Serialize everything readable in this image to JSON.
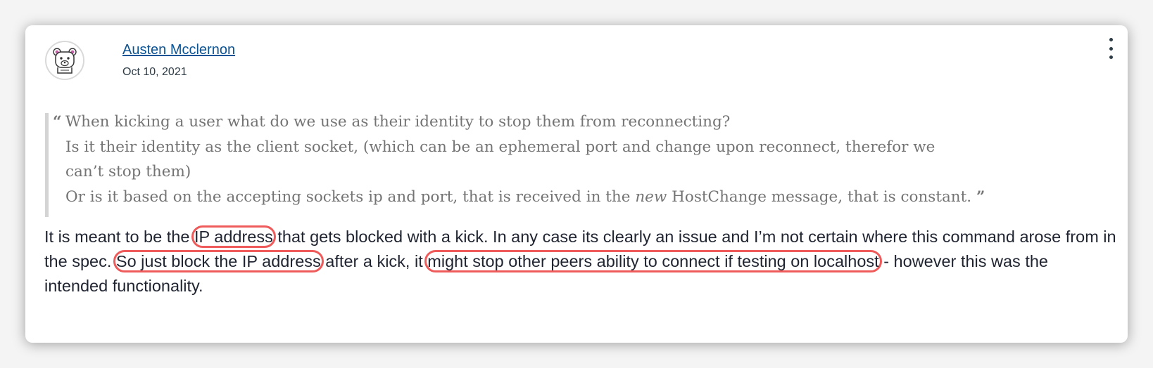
{
  "post": {
    "author": "Austen Mcclernon",
    "date": "Oct 10, 2021",
    "menu_icon": "kebab-menu-icon",
    "avatar_icon": "bear-avatar-icon"
  },
  "quote": {
    "line1": "When kicking a user what do we use as their identity to stop them from reconnecting?",
    "line2": "Is it their identity as the client socket, (which can be an ephemeral port and change upon reconnect, therefor we",
    "line3": "can’t stop them)",
    "line4_before": "Or is it based on the accepting sockets ip and port, that is received in the ",
    "line4_em": "new",
    "line4_after": " HostChange message, that is constant.",
    "open_mark": "“",
    "close_mark": "”"
  },
  "reply": {
    "l1_a": "It is meant to be the ",
    "l1_hl": "IP address",
    "l1_b": " that gets blocked with a kick. In any case its clearly an issue and I’m not certain where this command arose from in",
    "l2_a": "the spec. ",
    "l2_hl1": "So just block the IP address",
    "l2_b": " after a kick, it ",
    "l2_hl2": "might stop other peers ability to connect if testing on localhost",
    "l2_c": " - however this was the",
    "l3": "intended functionality."
  },
  "colors": {
    "highlight": "#ef5b5b",
    "link": "#0b5394",
    "quote_text": "#747474"
  }
}
